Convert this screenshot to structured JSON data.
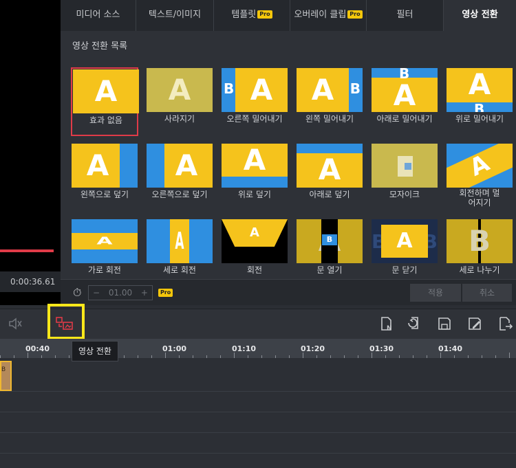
{
  "preview": {
    "time": "0:00:36.61"
  },
  "tabs": [
    {
      "label": "미디어 소스",
      "pro": false,
      "active": false
    },
    {
      "label": "텍스트/이미지",
      "pro": false,
      "active": false
    },
    {
      "label": "템플릿",
      "pro": true,
      "active": false
    },
    {
      "label": "오버레이 클립",
      "pro": true,
      "active": false
    },
    {
      "label": "필터",
      "pro": false,
      "active": false
    },
    {
      "label": "영상 전환",
      "pro": false,
      "active": true
    }
  ],
  "pro_badge": "Pro",
  "list_title": "영상 전환 목록",
  "transitions": [
    {
      "label": "효과 없음",
      "selected": true
    },
    {
      "label": "사라지기"
    },
    {
      "label": "오른쪽 밀어내기"
    },
    {
      "label": "왼쪽 밀어내기"
    },
    {
      "label": "아래로 밀어내기"
    },
    {
      "label": "위로 밀어내기"
    },
    {
      "label": "왼쪽으로 덮기"
    },
    {
      "label": "오른쪽으로 덮기"
    },
    {
      "label": "위로 덮기"
    },
    {
      "label": "아래로 덮기"
    },
    {
      "label": "모자이크"
    },
    {
      "label": "회전하며 멀어지기"
    },
    {
      "label": "가로 회전"
    },
    {
      "label": "세로 회전"
    },
    {
      "label": "회전"
    },
    {
      "label": "문 열기"
    },
    {
      "label": "문 닫기"
    },
    {
      "label": "세로 나누기"
    }
  ],
  "duration": {
    "minus": "−",
    "value": "01.00",
    "plus": "+"
  },
  "buttons": {
    "apply": "적용",
    "cancel": "취소"
  },
  "tooltip": "영상 전환",
  "ruler": [
    "00:40",
    "01:00",
    "01:10",
    "01:20",
    "01:30",
    "01:40"
  ],
  "clip_label": "B",
  "colors": {
    "accent": "#e03b48",
    "thumb_yellow": "#f5c31c",
    "thumb_blue": "#2f8fe0",
    "highlight": "#ffe81a"
  }
}
